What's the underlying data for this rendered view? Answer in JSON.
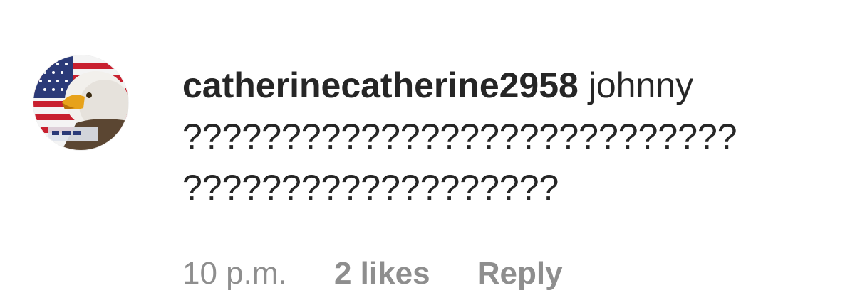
{
  "comment": {
    "avatar_icon": "eagle-flag-avatar-icon",
    "username": "catherinecatherine2958",
    "text_line1": "johnny",
    "text_line2": "????????????????????????????",
    "text_line3": "???????????????????",
    "timestamp": "10 p.m.",
    "likes": "2 likes",
    "reply_label": "Reply"
  },
  "colors": {
    "text_primary": "#262626",
    "text_secondary": "#8e8e8e",
    "background": "#ffffff"
  }
}
